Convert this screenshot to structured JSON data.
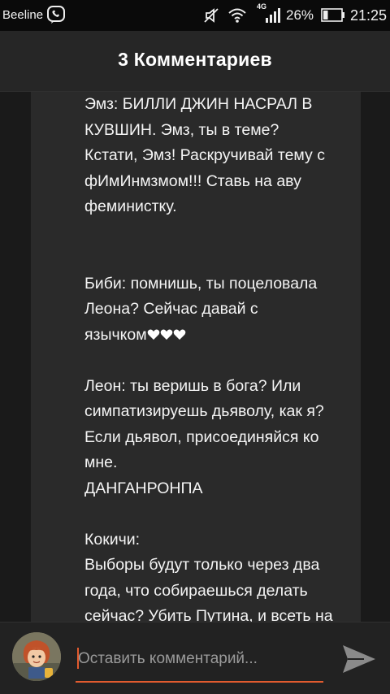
{
  "status_bar": {
    "carrier": "Beeline",
    "network": "4G",
    "battery_percent": "26%",
    "battery_level": 0.26,
    "time": "21:25",
    "icons": [
      "viber-icon",
      "mute-icon",
      "wifi-icon",
      "signal-icon",
      "battery-icon"
    ]
  },
  "header": {
    "title": "3 Комментариев"
  },
  "comment": {
    "lines": [
      "Эмз: БИЛЛИ ДЖИН НАСРАЛ В",
      "КУВШИН. Эмз, ты в теме?",
      "Кстати, Эмз! Раскручивай тему с",
      "фИмИнмзмом!!! Ставь на аву",
      "феминистку.",
      "",
      "",
      "Биби: помнишь, ты поцеловала",
      "Леона? Сейчас давай с",
      "язычком",
      "",
      "Леон: ты веришь в бога? Или",
      "симпатизируешь дьяволу, как я?",
      "Если дьявол, присоединяйся ко",
      "мне.",
      "ДАНГАНРОНПА",
      "",
      "Кокичи:",
      "Выборы будут только через два",
      "года, что собираешься делать",
      "сейчас? Убить Путина, и всеть на"
    ],
    "hearts_count": 3,
    "heart_color": "#ffffff"
  },
  "composer": {
    "placeholder": "Оставить комментарий...",
    "accent_color": "#e25b2f",
    "send_icon": "send-icon",
    "avatar_icon": "user-avatar"
  }
}
